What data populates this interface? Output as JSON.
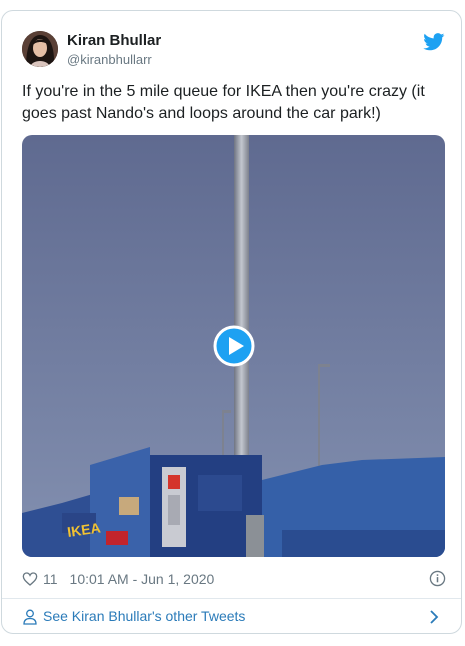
{
  "user": {
    "name": "Kiran Bhullar",
    "handle": "@kiranbhullarr"
  },
  "tweet": {
    "text": "If you're in the 5 mile queue for IKEA then you're crazy (it goes past Nando's and loops around the car park!)",
    "media_sign": "IKEA"
  },
  "meta": {
    "likes": "11",
    "timestamp": "10:01 AM - Jun 1, 2020"
  },
  "footer": {
    "more_label": "See Kiran Bhullar's other Tweets"
  },
  "icons": {
    "brand": "twitter-bird-icon",
    "play": "play-icon",
    "like": "heart-icon",
    "info": "info-icon",
    "profile": "person-icon",
    "chevron": "chevron-right-icon"
  },
  "colors": {
    "brand_blue": "#1da1f2",
    "link_blue": "#2b7bb9",
    "muted_text": "#697882",
    "border": "#cfd9de"
  }
}
